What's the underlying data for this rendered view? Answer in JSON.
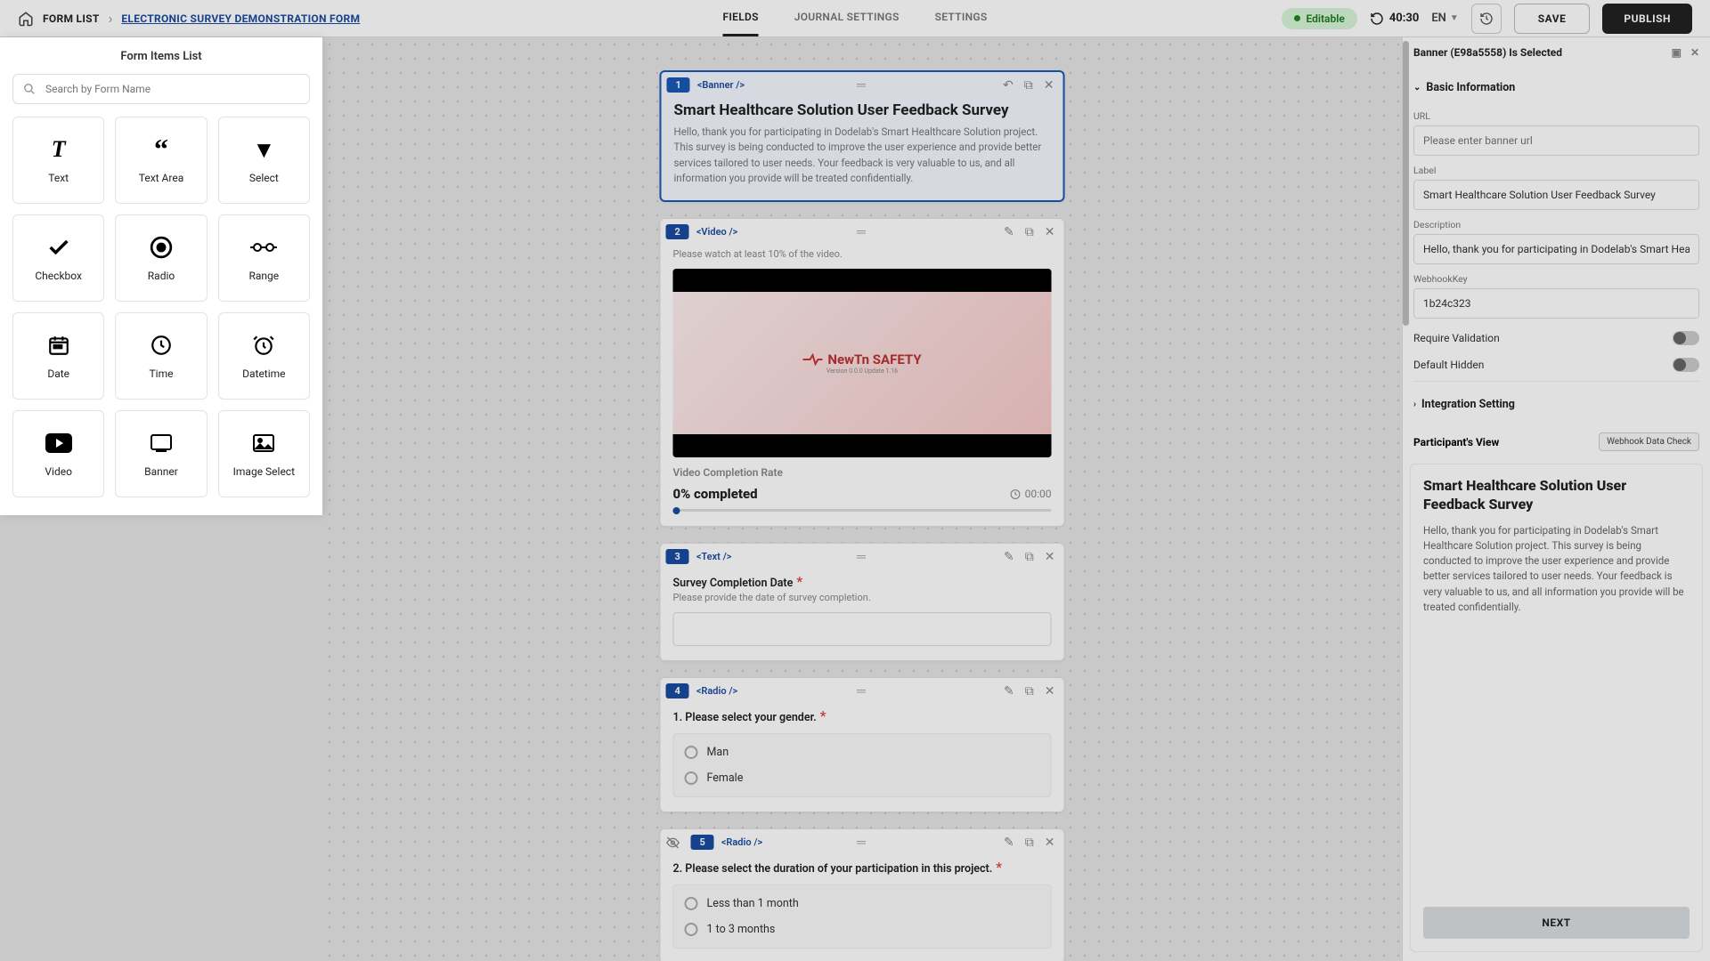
{
  "breadcrumb": {
    "home_aria": "Home",
    "level1": "FORM LIST",
    "level2": "ELECTRONIC SURVEY DEMONSTRATION FORM"
  },
  "tabs": {
    "fields": "FIELDS",
    "journal": "JOURNAL SETTINGS",
    "settings": "SETTINGS"
  },
  "header": {
    "editable": "Editable",
    "timer": "40:30",
    "lang": "EN",
    "save": "SAVE",
    "publish": "PUBLISH"
  },
  "leftPanel": {
    "title": "Form Items List",
    "search_placeholder": "Search by Form Name",
    "items": {
      "text": "Text",
      "textarea": "Text Area",
      "select": "Select",
      "checkbox": "Checkbox",
      "radio": "Radio",
      "range": "Range",
      "date": "Date",
      "time": "Time",
      "datetime": "Datetime",
      "video": "Video",
      "banner": "Banner",
      "imageselect": "Image Select"
    }
  },
  "canvas": {
    "c1": {
      "num": "1",
      "tag": "<Banner />",
      "title": "Smart Healthcare Solution User Feedback Survey",
      "desc": "Hello, thank you for participating in Dodelab's Smart Healthcare Solution project. This survey is being conducted to improve the user experience and provide better services tailored to user needs. Your feedback is very valuable to us, and all information you provide will be treated confidentially."
    },
    "c2": {
      "num": "2",
      "tag": "<Video />",
      "instruction": "Please watch at least 10% of the video.",
      "logo": "NewTn SAFETY",
      "logo_sub": "Version 0.0.0 Update 1.16",
      "vcr_label": "Video Completion Rate",
      "pct": "0% completed",
      "time": "00:00"
    },
    "c3": {
      "num": "3",
      "tag": "<Text />",
      "label": "Survey Completion Date",
      "helper": "Please provide the date of survey completion."
    },
    "c4": {
      "num": "4",
      "tag": "<Radio />",
      "label": "1. Please select your gender.",
      "opt1": "Man",
      "opt2": "Female"
    },
    "c5": {
      "num": "5",
      "tag": "<Radio />",
      "label": "2. Please select the duration of your participation in this project.",
      "opt1": "Less than 1 month",
      "opt2": "1 to 3 months"
    }
  },
  "rightPanel": {
    "selected": "Banner (E98a5558) Is Selected",
    "acc1": "Basic Information",
    "url_label": "URL",
    "url_placeholder": "Please enter banner url",
    "label_label": "Label",
    "label_value": "Smart Healthcare Solution User Feedback Survey",
    "desc_label": "Description",
    "desc_value": "Hello, thank you for participating in Dodelab's Smart Health",
    "webhook_label": "WebhookKey",
    "webhook_value": "1b24c323",
    "require_validation": "Require Validation",
    "default_hidden": "Default Hidden",
    "acc2": "Integration Setting",
    "pv_title": "Participant's View",
    "webhook_check": "Webhook Data Check",
    "preview_title": "Smart Healthcare Solution User Feedback Survey",
    "preview_body": "Hello, thank you for participating in Dodelab's Smart Healthcare Solution project. This survey is being conducted to improve the user experience and provide better services tailored to user needs. Your feedback is very valuable to us, and all information you provide will be treated confidentially.",
    "next": "NEXT"
  }
}
